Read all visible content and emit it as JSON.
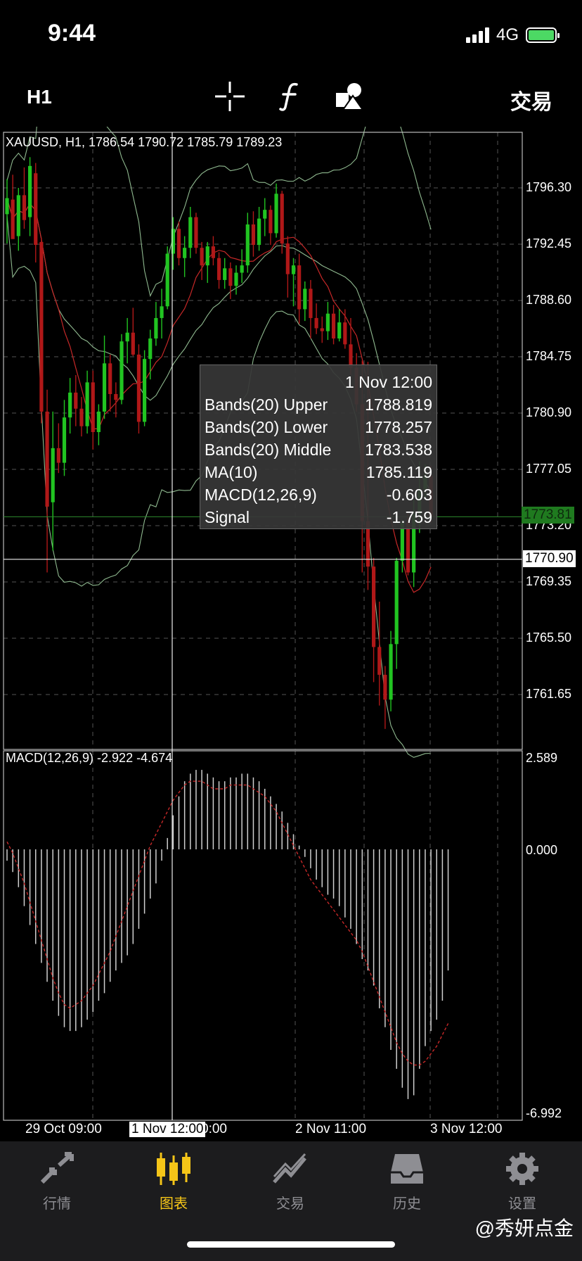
{
  "status_bar": {
    "time": "9:44",
    "network": "4G"
  },
  "toolbar": {
    "timeframe": "H1",
    "icons": [
      "crosshair-icon",
      "function-icon",
      "objects-icon"
    ],
    "trade_label": "交易"
  },
  "main_chart": {
    "title": "XAUUSD, H1, 1786.54 1790.72 1785.79 1789.23",
    "price_labels": [
      "1796.30",
      "1792.45",
      "1788.60",
      "1784.75",
      "1780.90",
      "1777.05",
      "1773.20",
      "1769.35",
      "1765.50",
      "1761.65"
    ],
    "current_price": "1773.81",
    "cursor_price": "1770.90",
    "colors": {
      "bull": "#21c421",
      "bear": "#b01818",
      "band": "#8fb98f",
      "ma": "#c62828",
      "current_price_bg": "#1f7a1f"
    }
  },
  "tooltip": {
    "time": "1 Nov 12:00",
    "rows": [
      {
        "label": "Bands(20) Upper",
        "value": "1788.819"
      },
      {
        "label": "Bands(20) Lower",
        "value": "1778.257"
      },
      {
        "label": "Bands(20) Middle",
        "value": "1783.538"
      },
      {
        "label": "MA(10)",
        "value": "1785.119"
      },
      {
        "label": "MACD(12,26,9)",
        "value": "-0.603"
      },
      {
        "label": "Signal",
        "value": "-1.759"
      }
    ]
  },
  "macd_chart": {
    "title": "MACD(12,26,9) -2.922 -4.674",
    "labels": {
      "top": "2.589",
      "zero": "0.000",
      "bottom": "-6.992"
    }
  },
  "x_axis": {
    "labels": [
      "29 Oct 09:00",
      "0:00",
      "2 Nov 11:00",
      "3 Nov 12:00"
    ],
    "cursor_label": "1 Nov 12:00"
  },
  "bottom_nav": {
    "items": [
      {
        "label": "行情",
        "icon": "arrows-icon",
        "active": false
      },
      {
        "label": "图表",
        "icon": "candles-icon",
        "active": true
      },
      {
        "label": "交易",
        "icon": "trend-icon",
        "active": false
      },
      {
        "label": "历史",
        "icon": "inbox-icon",
        "active": false
      },
      {
        "label": "设置",
        "icon": "gear-icon",
        "active": false
      }
    ]
  },
  "watermark": "@秀妍点金",
  "chart_data": [
    {
      "type": "candlestick",
      "title": "XAUUSD, H1, 1786.54 1790.72 1785.79 1789.23",
      "ylim": [
        1758,
        1799
      ],
      "candles": [
        {
          "o": 1794.5,
          "h": 1796.9,
          "l": 1792.5,
          "c": 1795.6
        },
        {
          "o": 1795.5,
          "h": 1797.2,
          "l": 1793.0,
          "c": 1792.8
        },
        {
          "o": 1793.0,
          "h": 1796.3,
          "l": 1792.0,
          "c": 1795.8
        },
        {
          "o": 1795.8,
          "h": 1797.7,
          "l": 1793.5,
          "c": 1794.1
        },
        {
          "o": 1794.3,
          "h": 1798.4,
          "l": 1793.0,
          "c": 1797.8
        },
        {
          "o": 1797.3,
          "h": 1798.0,
          "l": 1791.2,
          "c": 1792.4
        },
        {
          "o": 1792.6,
          "h": 1792.9,
          "l": 1780.2,
          "c": 1781.0
        },
        {
          "o": 1781.0,
          "h": 1782.5,
          "l": 1770.0,
          "c": 1774.5
        },
        {
          "o": 1774.8,
          "h": 1781.0,
          "l": 1771.5,
          "c": 1778.5
        },
        {
          "o": 1778.5,
          "h": 1780.2,
          "l": 1776.8,
          "c": 1777.5
        },
        {
          "o": 1777.5,
          "h": 1781.8,
          "l": 1776.6,
          "c": 1780.6
        },
        {
          "o": 1780.6,
          "h": 1783.3,
          "l": 1779.5,
          "c": 1782.3
        },
        {
          "o": 1782.3,
          "h": 1783.5,
          "l": 1780.0,
          "c": 1781.2
        },
        {
          "o": 1781.2,
          "h": 1782.0,
          "l": 1779.3,
          "c": 1780.0
        },
        {
          "o": 1780.0,
          "h": 1783.8,
          "l": 1779.5,
          "c": 1783.0
        },
        {
          "o": 1783.0,
          "h": 1783.8,
          "l": 1778.4,
          "c": 1779.6
        },
        {
          "o": 1779.6,
          "h": 1781.5,
          "l": 1778.7,
          "c": 1781.0
        },
        {
          "o": 1781.0,
          "h": 1786.2,
          "l": 1780.5,
          "c": 1784.3
        },
        {
          "o": 1784.3,
          "h": 1784.9,
          "l": 1781.0,
          "c": 1782.2
        },
        {
          "o": 1782.2,
          "h": 1783.0,
          "l": 1780.6,
          "c": 1781.8
        },
        {
          "o": 1781.8,
          "h": 1786.3,
          "l": 1781.5,
          "c": 1785.8
        },
        {
          "o": 1785.8,
          "h": 1787.4,
          "l": 1784.3,
          "c": 1786.4
        },
        {
          "o": 1786.4,
          "h": 1788.1,
          "l": 1784.8,
          "c": 1784.9
        },
        {
          "o": 1784.9,
          "h": 1785.6,
          "l": 1779.5,
          "c": 1780.3
        },
        {
          "o": 1780.3,
          "h": 1785.2,
          "l": 1780.0,
          "c": 1784.6
        },
        {
          "o": 1784.6,
          "h": 1786.6,
          "l": 1783.2,
          "c": 1786.0
        },
        {
          "o": 1786.0,
          "h": 1788.5,
          "l": 1785.5,
          "c": 1787.4
        },
        {
          "o": 1787.4,
          "h": 1789.4,
          "l": 1786.0,
          "c": 1788.2
        },
        {
          "o": 1788.2,
          "h": 1792.3,
          "l": 1788.0,
          "c": 1791.8
        },
        {
          "o": 1791.8,
          "h": 1794.3,
          "l": 1790.7,
          "c": 1793.5
        },
        {
          "o": 1793.5,
          "h": 1794.0,
          "l": 1791.0,
          "c": 1791.5
        },
        {
          "o": 1791.5,
          "h": 1793.0,
          "l": 1790.2,
          "c": 1792.2
        },
        {
          "o": 1792.2,
          "h": 1795.0,
          "l": 1791.5,
          "c": 1794.3
        },
        {
          "o": 1794.3,
          "h": 1794.6,
          "l": 1791.8,
          "c": 1792.2
        },
        {
          "o": 1792.2,
          "h": 1792.6,
          "l": 1790.0,
          "c": 1791.0
        },
        {
          "o": 1791.0,
          "h": 1792.6,
          "l": 1789.8,
          "c": 1792.3
        },
        {
          "o": 1792.3,
          "h": 1793.0,
          "l": 1791.0,
          "c": 1791.5
        },
        {
          "o": 1791.5,
          "h": 1791.9,
          "l": 1789.4,
          "c": 1790.0
        },
        {
          "o": 1790.0,
          "h": 1791.5,
          "l": 1789.4,
          "c": 1790.8
        },
        {
          "o": 1790.8,
          "h": 1791.2,
          "l": 1788.7,
          "c": 1789.6
        },
        {
          "o": 1789.6,
          "h": 1791.0,
          "l": 1789.0,
          "c": 1790.5
        },
        {
          "o": 1790.5,
          "h": 1792.1,
          "l": 1789.8,
          "c": 1791.0
        },
        {
          "o": 1791.0,
          "h": 1794.6,
          "l": 1790.5,
          "c": 1793.8
        },
        {
          "o": 1793.8,
          "h": 1794.7,
          "l": 1791.6,
          "c": 1792.4
        },
        {
          "o": 1792.4,
          "h": 1795.0,
          "l": 1792.0,
          "c": 1794.2
        },
        {
          "o": 1794.2,
          "h": 1795.6,
          "l": 1793.0,
          "c": 1794.8
        },
        {
          "o": 1794.8,
          "h": 1795.1,
          "l": 1792.4,
          "c": 1793.2
        },
        {
          "o": 1793.2,
          "h": 1796.6,
          "l": 1792.9,
          "c": 1795.9
        },
        {
          "o": 1795.9,
          "h": 1796.1,
          "l": 1791.8,
          "c": 1792.5
        },
        {
          "o": 1792.5,
          "h": 1793.0,
          "l": 1788.8,
          "c": 1790.4
        },
        {
          "o": 1790.4,
          "h": 1791.5,
          "l": 1788.2,
          "c": 1791.0
        },
        {
          "o": 1791.0,
          "h": 1791.8,
          "l": 1787.0,
          "c": 1788.0
        },
        {
          "o": 1788.0,
          "h": 1789.9,
          "l": 1787.2,
          "c": 1789.4
        },
        {
          "o": 1789.4,
          "h": 1790.0,
          "l": 1786.0,
          "c": 1787.4
        },
        {
          "o": 1787.4,
          "h": 1788.4,
          "l": 1786.3,
          "c": 1786.7
        },
        {
          "o": 1786.7,
          "h": 1787.5,
          "l": 1785.7,
          "c": 1786.5
        },
        {
          "o": 1786.5,
          "h": 1788.5,
          "l": 1785.9,
          "c": 1787.7
        },
        {
          "o": 1787.7,
          "h": 1788.3,
          "l": 1785.6,
          "c": 1786.0
        },
        {
          "o": 1786.0,
          "h": 1788.0,
          "l": 1785.8,
          "c": 1787.1
        },
        {
          "o": 1787.1,
          "h": 1788.0,
          "l": 1785.3,
          "c": 1785.6
        },
        {
          "o": 1785.6,
          "h": 1787.4,
          "l": 1783.5,
          "c": 1784.0
        },
        {
          "o": 1784.0,
          "h": 1785.0,
          "l": 1781.0,
          "c": 1781.5
        },
        {
          "o": 1781.5,
          "h": 1784.5,
          "l": 1770.0,
          "c": 1773.5
        },
        {
          "o": 1773.5,
          "h": 1784.4,
          "l": 1768.8,
          "c": 1770.4
        },
        {
          "o": 1770.4,
          "h": 1771.0,
          "l": 1762.5,
          "c": 1764.9
        },
        {
          "o": 1764.9,
          "h": 1768.0,
          "l": 1760.9,
          "c": 1763.0
        },
        {
          "o": 1763.0,
          "h": 1763.6,
          "l": 1759.3,
          "c": 1761.3
        },
        {
          "o": 1761.3,
          "h": 1766.0,
          "l": 1760.5,
          "c": 1765.1
        },
        {
          "o": 1765.1,
          "h": 1771.0,
          "l": 1763.4,
          "c": 1770.8
        },
        {
          "o": 1770.8,
          "h": 1773.6,
          "l": 1770.0,
          "c": 1773.4
        },
        {
          "o": 1773.4,
          "h": 1774.0,
          "l": 1769.8,
          "c": 1770.0
        },
        {
          "o": 1770.0,
          "h": 1775.0,
          "l": 1769.0,
          "c": 1774.0
        },
        {
          "o": 1774.0,
          "h": 1777.6,
          "l": 1772.7,
          "c": 1775.7
        },
        {
          "o": 1775.7,
          "h": 1777.4,
          "l": 1775.1,
          "c": 1776.6
        },
        {
          "o": 1776.6,
          "h": 1777.3,
          "l": 1773.4,
          "c": 1773.8
        }
      ]
    },
    {
      "type": "bar",
      "title": "MACD(12,26,9) -2.922 -4.674",
      "ylim": [
        -6.992,
        2.589
      ],
      "histogram": [
        -0.3,
        -0.6,
        -1.0,
        -1.5,
        -2.0,
        -2.5,
        -3.0,
        -3.5,
        -4.0,
        -4.4,
        -4.7,
        -4.8,
        -4.8,
        -4.7,
        -4.5,
        -4.3,
        -4.0,
        -3.8,
        -3.5,
        -3.2,
        -3.0,
        -2.8,
        -2.5,
        -2.1,
        -1.7,
        -1.3,
        -0.9,
        -0.3,
        0.3,
        0.9,
        1.4,
        1.8,
        2.0,
        2.1,
        2.1,
        2.0,
        1.9,
        1.8,
        1.8,
        1.9,
        1.9,
        2.0,
        2.0,
        1.9,
        1.8,
        1.6,
        1.4,
        1.2,
        1.0,
        0.7,
        0.4,
        0.1,
        -0.2,
        -0.5,
        -0.8,
        -1.0,
        -1.2,
        -1.3,
        -1.5,
        -1.8,
        -2.1,
        -2.5,
        -2.9,
        -3.2,
        -3.6,
        -4.2,
        -4.7,
        -5.3,
        -5.8,
        -6.3,
        -6.6,
        -6.5,
        -5.8,
        -5.2,
        -4.8,
        -4.5,
        -4.0,
        -3.2
      ],
      "signal": [
        0.2,
        -0.1,
        -0.5,
        -0.9,
        -1.4,
        -1.9,
        -2.4,
        -2.9,
        -3.4,
        -3.8,
        -4.1,
        -4.2,
        -4.1,
        -4.0,
        -3.8,
        -3.6,
        -3.3,
        -3.0,
        -2.7,
        -2.3,
        -1.9,
        -1.5,
        -1.1,
        -0.7,
        -0.3,
        0.1,
        0.4,
        0.7,
        1.0,
        1.3,
        1.5,
        1.7,
        1.8,
        1.8,
        1.8,
        1.7,
        1.6,
        1.6,
        1.6,
        1.7,
        1.7,
        1.7,
        1.7,
        1.6,
        1.5,
        1.4,
        1.2,
        1.0,
        0.7,
        0.4,
        0.1,
        -0.2,
        -0.5,
        -0.8,
        -1.0,
        -1.2,
        -1.4,
        -1.6,
        -1.8,
        -2.0,
        -2.2,
        -2.4,
        -2.7,
        -3.1,
        -3.5,
        -3.9,
        -4.3,
        -4.7,
        -5.1,
        -5.4,
        -5.6,
        -5.7,
        -5.7,
        -5.6,
        -5.4,
        -5.2,
        -4.9,
        -4.6
      ]
    }
  ]
}
